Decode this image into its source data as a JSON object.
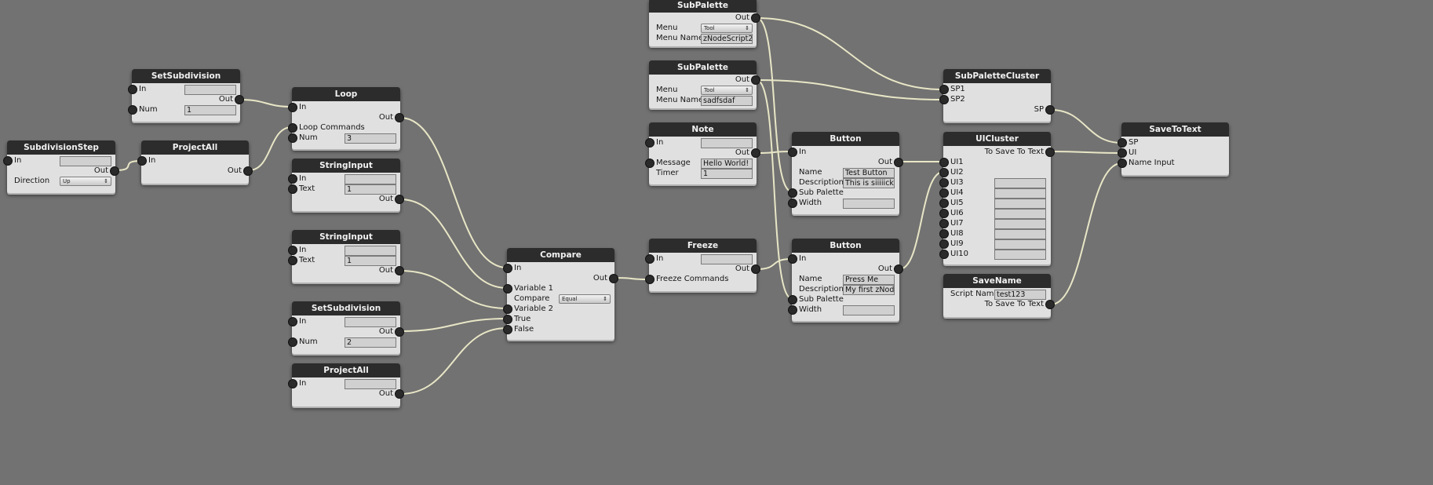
{
  "canvas": {
    "background": "#727272",
    "wire_color": "#e8e6c6"
  },
  "nodes": {
    "subdivision_step": {
      "title": "SubdivisionStep",
      "in": "In",
      "out": "Out",
      "direction_label": "Direction",
      "direction_value": "Up"
    },
    "project_all_1": {
      "title": "ProjectAll",
      "in": "In",
      "out": "Out"
    },
    "set_subdivision_1": {
      "title": "SetSubdivision",
      "in": "In",
      "out": "Out",
      "num_label": "Num",
      "num_value": "1"
    },
    "loop": {
      "title": "Loop",
      "in": "In",
      "out": "Out",
      "commands": "Loop Commands",
      "num_label": "Num",
      "num_value": "3"
    },
    "string_input_1": {
      "title": "StringInput",
      "in": "In",
      "text_label": "Text",
      "text_value": "1",
      "out": "Out"
    },
    "string_input_2": {
      "title": "StringInput",
      "in": "In",
      "text_label": "Text",
      "text_value": "1",
      "out": "Out"
    },
    "set_subdivision_2": {
      "title": "SetSubdivision",
      "in": "In",
      "out": "Out",
      "num_label": "Num",
      "num_value": "2"
    },
    "project_all_2": {
      "title": "ProjectAll",
      "in": "In",
      "out": "Out"
    },
    "compare": {
      "title": "Compare",
      "in": "In",
      "out": "Out",
      "variable1": "Variable 1",
      "compare_label": "Compare",
      "compare_value": "Equal",
      "variable2": "Variable 2",
      "true_label": "True",
      "false_label": "False"
    },
    "sub_palette_1": {
      "title": "SubPalette",
      "out": "Out",
      "menu_label": "Menu",
      "menu_value": "Tool",
      "menu_name_label": "Menu Name",
      "menu_name_value": "zNodeScript2"
    },
    "sub_palette_2": {
      "title": "SubPalette",
      "out": "Out",
      "menu_label": "Menu",
      "menu_value": "Tool",
      "menu_name_label": "Menu Name",
      "menu_name_value": "sadfsdaf"
    },
    "note": {
      "title": "Note",
      "in": "In",
      "out": "Out",
      "message_label": "Message",
      "message_value": "Hello World!",
      "timer_label": "Timer",
      "timer_value": "1"
    },
    "freeze": {
      "title": "Freeze",
      "in": "In",
      "out": "Out",
      "commands": "Freeze Commands"
    },
    "button_1": {
      "title": "Button",
      "in": "In",
      "out": "Out",
      "name_label": "Name",
      "name_value": "Test Button",
      "description_label": "Description",
      "description_value": "This is siiiiick",
      "sub_palette": "Sub Palette",
      "width_label": "Width"
    },
    "button_2": {
      "title": "Button",
      "in": "In",
      "out": "Out",
      "name_label": "Name",
      "name_value": "Press Me",
      "description_label": "Description",
      "description_value": "My first zNode",
      "sub_palette": "Sub Palette",
      "width_label": "Width"
    },
    "sub_palette_cluster": {
      "title": "SubPaletteCluster",
      "sp1": "SP1",
      "sp2": "SP2",
      "sp": "SP"
    },
    "ui_cluster": {
      "title": "UICluster",
      "to_save": "To Save To Text",
      "ui1": "UI1",
      "ui2": "UI2",
      "ui3": "UI3",
      "ui4": "UI4",
      "ui5": "UI5",
      "ui6": "UI6",
      "ui7": "UI7",
      "ui8": "UI8",
      "ui9": "UI9",
      "ui10": "UI10"
    },
    "save_name": {
      "title": "SaveName",
      "script_name_label": "Script Name",
      "script_name_value": "test123",
      "to_save": "To Save To Text"
    },
    "save_to_text": {
      "title": "SaveToText",
      "sp": "SP",
      "ui": "UI",
      "name_input": "Name Input"
    }
  }
}
